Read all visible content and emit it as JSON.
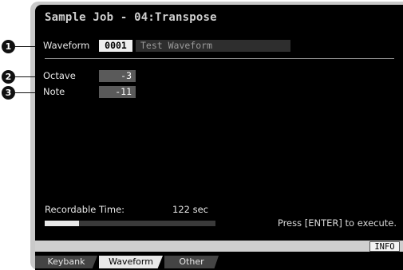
{
  "screen": {
    "title": "Sample Job - 04:Transpose"
  },
  "params": {
    "waveform": {
      "label": "Waveform",
      "number": "0001",
      "name": "Test Waveform"
    },
    "octave": {
      "label": "Octave",
      "value": "-3"
    },
    "note": {
      "label": "Note",
      "value": "-11"
    }
  },
  "recordable": {
    "label": "Recordable Time:",
    "value": "122 sec",
    "progress_fraction": 0.2
  },
  "hint": "Press [ENTER] to execute.",
  "info_button": "INFO",
  "tabs": [
    {
      "label": "Keybank",
      "active": false
    },
    {
      "label": "Waveform",
      "active": true
    },
    {
      "label": "Other",
      "active": false
    }
  ],
  "callouts": [
    "1",
    "2",
    "3"
  ]
}
